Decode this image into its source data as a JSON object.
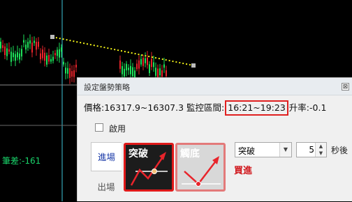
{
  "chart": {
    "diff_label": "筆差:-161",
    "colors": {
      "up": "#e8242b",
      "down": "#1ee05a",
      "trendline": "#f2f218",
      "crosshair": "#3ec3d8"
    }
  },
  "dialog": {
    "title": "設定盤勢策略",
    "close_glyph": "⊠",
    "price_label": "價格:16317.9~16307.3 監控區間:",
    "monitor_range": "16:21~19:23",
    "rise_rate": "升率:-0.1",
    "enable_label": "啟用",
    "tabs": {
      "entry": "進場",
      "exit": "出場"
    },
    "cards": {
      "breakout": "突破",
      "touch_bottom": "觸底"
    },
    "strategy_select": {
      "value": "突破"
    },
    "seconds": {
      "value": "5",
      "unit": "秒後"
    },
    "action": "買進",
    "icons": {
      "select_arrow": "chevron-down-icon",
      "spin_up": "triangle-up-icon",
      "spin_down": "triangle-down-icon"
    }
  }
}
